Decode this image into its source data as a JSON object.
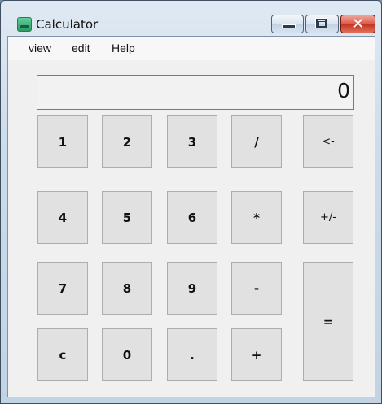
{
  "window": {
    "title": "Calculator",
    "controls": {
      "minimize": "minimize",
      "maximize": "maximize",
      "close": "✕"
    }
  },
  "menu": {
    "view": "view",
    "edit": "edit",
    "help": "Help"
  },
  "display": {
    "value": "0"
  },
  "keys": {
    "k1": "1",
    "k2": "2",
    "k3": "3",
    "divide": "/",
    "backspace": "<-",
    "k4": "4",
    "k5": "5",
    "k6": "6",
    "multiply": "*",
    "sign": "+/-",
    "k7": "7",
    "k8": "8",
    "k9": "9",
    "minus": "-",
    "equals": "=",
    "clear": "c",
    "k0": "0",
    "decimal": ".",
    "plus": "+"
  }
}
